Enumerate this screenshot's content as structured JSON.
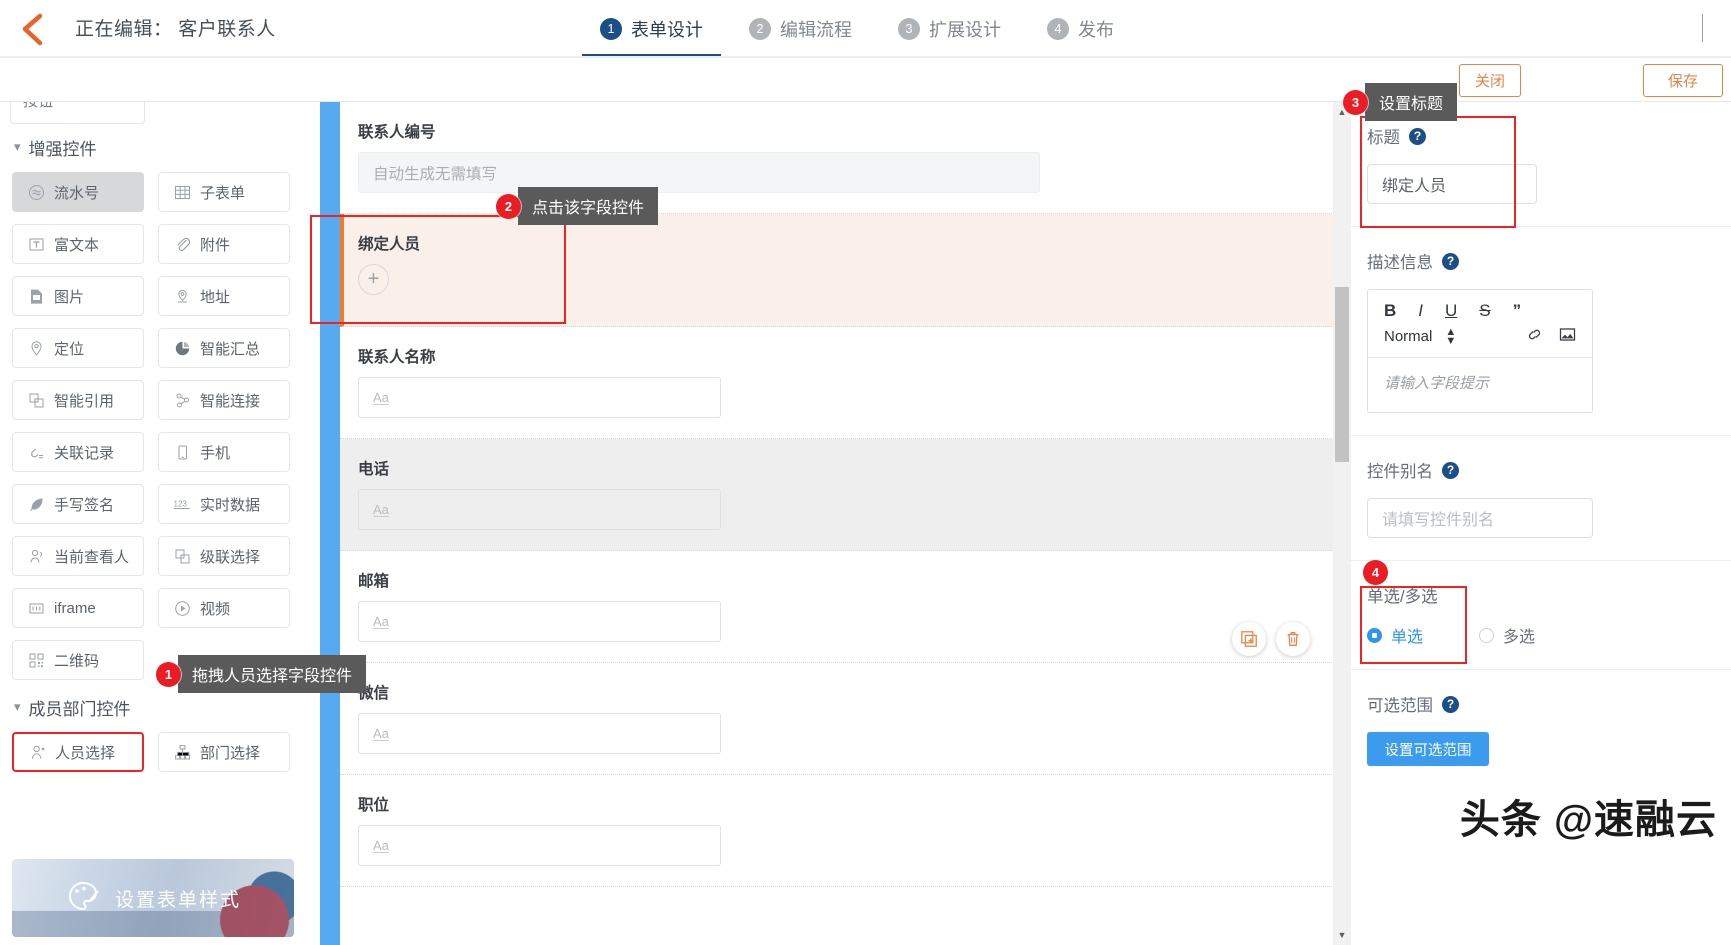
{
  "topbar": {
    "breadcrumb": "正在编辑： 客户联系人",
    "back_icon": "chevron-left-icon",
    "steps": [
      {
        "num": "1",
        "label": "表单设计",
        "active": true
      },
      {
        "num": "2",
        "label": "编辑流程",
        "active": false
      },
      {
        "num": "3",
        "label": "扩展设计",
        "active": false
      },
      {
        "num": "4",
        "label": "发布",
        "active": false
      }
    ]
  },
  "actionbar": {
    "close_label": "关闭",
    "save_label": "保存"
  },
  "sidebar": {
    "clipped_top_item": "按钮",
    "sections": [
      {
        "title": "增强控件",
        "items": [
          {
            "label": "流水号",
            "icon": "serial-number-icon",
            "state": "selected"
          },
          {
            "label": "子表单",
            "icon": "table-icon",
            "state": "normal"
          },
          {
            "label": "富文本",
            "icon": "rich-text-icon",
            "state": "normal"
          },
          {
            "label": "附件",
            "icon": "paperclip-icon",
            "state": "normal"
          },
          {
            "label": "图片",
            "icon": "image-icon",
            "state": "normal"
          },
          {
            "label": "地址",
            "icon": "address-pin-icon",
            "state": "normal"
          },
          {
            "label": "定位",
            "icon": "location-icon",
            "state": "normal"
          },
          {
            "label": "智能汇总",
            "icon": "pie-chart-icon",
            "state": "normal"
          },
          {
            "label": "智能引用",
            "icon": "copy-ref-icon",
            "state": "normal"
          },
          {
            "label": "智能连接",
            "icon": "node-link-icon",
            "state": "normal"
          },
          {
            "label": "关联记录",
            "icon": "link-record-icon",
            "state": "normal"
          },
          {
            "label": "手机",
            "icon": "mobile-icon",
            "state": "normal"
          },
          {
            "label": "手写签名",
            "icon": "feather-icon",
            "state": "normal"
          },
          {
            "label": "实时数据",
            "icon": "numbers-123-icon",
            "state": "normal"
          },
          {
            "label": "当前查看人",
            "icon": "user-view-icon",
            "state": "normal"
          },
          {
            "label": "级联选择",
            "icon": "cascade-icon",
            "state": "normal"
          },
          {
            "label": "iframe",
            "icon": "iframe-icon",
            "state": "normal"
          },
          {
            "label": "视频",
            "icon": "play-circle-icon",
            "state": "normal"
          }
        ]
      },
      {
        "title": "",
        "items": [
          {
            "label": "二维码",
            "icon": "qr-code-icon",
            "state": "normal"
          }
        ]
      },
      {
        "title": "成员部门控件",
        "items": [
          {
            "label": "人员选择",
            "icon": "person-select-icon",
            "state": "highlighted"
          },
          {
            "label": "部门选择",
            "icon": "department-tree-icon",
            "state": "normal"
          }
        ]
      }
    ],
    "style_card": {
      "label": "设置表单样式",
      "icon": "palette-icon"
    }
  },
  "form": {
    "fields": [
      {
        "label": "联系人编号",
        "placeholder": "自动生成无需填写",
        "input_type": "wide-readonly",
        "style": "plain"
      },
      {
        "label": "绑定人员",
        "placeholder": "",
        "input_type": "person-add",
        "style": "selected"
      },
      {
        "label": "联系人名称",
        "placeholder": "Aa",
        "input_type": "text",
        "style": "plain"
      },
      {
        "label": "电话",
        "placeholder": "Aa",
        "input_type": "text",
        "style": "alt"
      },
      {
        "label": "邮箱",
        "placeholder": "Aa",
        "input_type": "text",
        "style": "plain"
      },
      {
        "label": "微信",
        "placeholder": "Aa",
        "input_type": "text",
        "style": "plain"
      },
      {
        "label": "职位",
        "placeholder": "Aa",
        "input_type": "text",
        "style": "plain"
      }
    ],
    "float_actions": [
      {
        "name": "copy-field",
        "icon": "copy-icon"
      },
      {
        "name": "delete-field",
        "icon": "trash-icon"
      }
    ]
  },
  "right_panel": {
    "title_section": {
      "label": "标题",
      "value": "绑定人员"
    },
    "desc_section": {
      "label": "描述信息",
      "placeholder": "请输入字段提示",
      "toolbar": [
        "B",
        "I",
        "U",
        "S",
        "”"
      ],
      "format_select": "Normal",
      "toolbar_icons": [
        "link-icon",
        "image-icon"
      ]
    },
    "alias_section": {
      "label": "控件别名",
      "placeholder": "请填写控件别名"
    },
    "choice_section": {
      "label": "单选/多选",
      "options": [
        {
          "label": "单选",
          "selected": true
        },
        {
          "label": "多选",
          "selected": false
        }
      ]
    },
    "range_section": {
      "label": "可选范围",
      "button_label": "设置可选范围"
    }
  },
  "callouts": [
    {
      "num": "1",
      "text": "拖拽人员选择字段控件"
    },
    {
      "num": "2",
      "text": "点击该字段控件"
    },
    {
      "num": "3",
      "text": "设置标题"
    },
    {
      "num": "4",
      "text": ""
    }
  ],
  "watermark": {
    "text": "头条 @速融云"
  },
  "colors": {
    "accent_orange": "#e8834a",
    "accent_blue": "#3a9bef",
    "rail_blue": "#56aaf0",
    "step_active": "#1c4f87",
    "highlight_red": "#f02222",
    "selected_field_bg": "#fbefe9"
  }
}
